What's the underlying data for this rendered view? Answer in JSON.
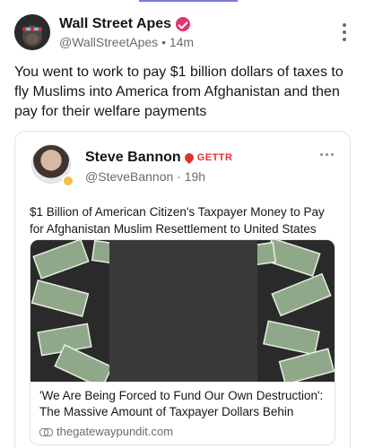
{
  "colors": {
    "verified_badge": "#e5336e",
    "gettr_red": "#e0312c",
    "muted_text": "#6b6b6b",
    "accent_bar": "#7b7be0"
  },
  "post": {
    "author": {
      "display_name": "Wall Street Apes",
      "handle_time": "@WallStreetApes • 14m",
      "avatar_icon": "gorilla-avatar",
      "verified_icon": "verified-check-icon"
    },
    "more_icon": "kebab-menu-icon",
    "text": "You went to work to pay $1 billion dollars of taxes to fly Muslims into America from Afghanistan and then pay for their welfare payments"
  },
  "quoted": {
    "author": {
      "display_name": "Steve Bannon",
      "platform_badge": "GETTR",
      "handle_time": "@SteveBannon · 19h",
      "avatar_icon": "profile-photo"
    },
    "more_icon": "more-dots-icon",
    "text": "$1 Billion of American Citizen's Taxpayer Money to Pay for Afghanistan Muslim Resettlement to United States",
    "link_card": {
      "image_icon": "article-photo",
      "title": "'We Are Being Forced to Fund Our Own Destruction': The Massive Amount of Taxpayer Dollars Behin",
      "domain": "thegatewaypundit.com",
      "domain_icon": "link-icon"
    }
  }
}
